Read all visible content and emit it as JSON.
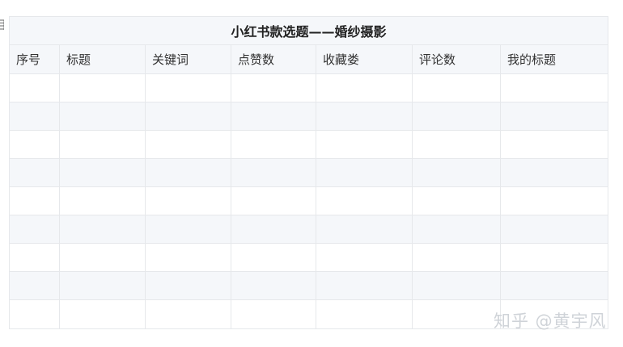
{
  "left_edge_glyph": "泪",
  "table": {
    "title": "小红书款选题——婚纱摄影",
    "columns": [
      "序号",
      "标题",
      "关键词",
      "点赞数",
      "收藏娄",
      "评论数",
      "我的标题"
    ],
    "rows": [
      [
        "",
        "",
        "",
        "",
        "",
        "",
        ""
      ],
      [
        "",
        "",
        "",
        "",
        "",
        "",
        ""
      ],
      [
        "",
        "",
        "",
        "",
        "",
        "",
        ""
      ],
      [
        "",
        "",
        "",
        "",
        "",
        "",
        ""
      ],
      [
        "",
        "",
        "",
        "",
        "",
        "",
        ""
      ],
      [
        "",
        "",
        "",
        "",
        "",
        "",
        ""
      ],
      [
        "",
        "",
        "",
        "",
        "",
        "",
        ""
      ],
      [
        "",
        "",
        "",
        "",
        "",
        "",
        ""
      ],
      [
        "",
        "",
        "",
        "",
        "",
        "",
        ""
      ]
    ]
  },
  "watermark": "知乎 @黄宇风",
  "colors": {
    "header_bg": "#f5f7fa",
    "grid_line": "#e6e8eb",
    "text": "#333333",
    "watermark": "#cfd3d8"
  }
}
